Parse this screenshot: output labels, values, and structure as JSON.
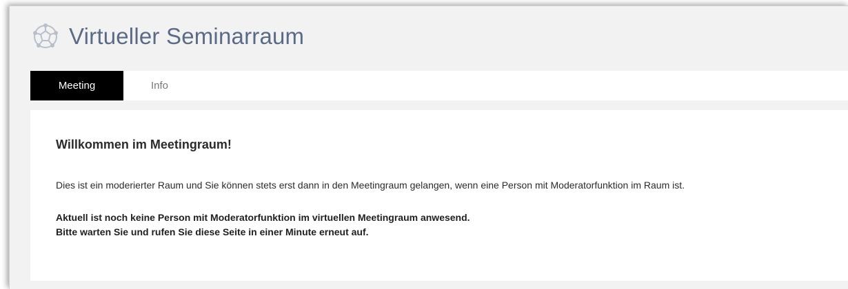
{
  "header": {
    "title": "Virtueller Seminarraum",
    "logo_icon": "network-globe-icon"
  },
  "tabs": [
    {
      "label": "Meeting",
      "active": true
    },
    {
      "label": "Info",
      "active": false
    }
  ],
  "content": {
    "heading": "Willkommen im Meetingraum!",
    "description": "Dies ist ein moderierter Raum und Sie können stets erst dann in den Meetingraum gelangen, wenn eine Person mit Moderatorfunktion im Raum ist.",
    "notice_line1": "Aktuell ist noch keine Person mit Moderatorfunktion im virtuellen Meetingraum anwesend.",
    "notice_line2": "Bitte warten Sie und rufen Sie diese Seite in einer Minute erneut auf."
  },
  "colors": {
    "title": "#5b6b85",
    "active_tab_bg": "#000000",
    "background": "#f2f2f2"
  }
}
